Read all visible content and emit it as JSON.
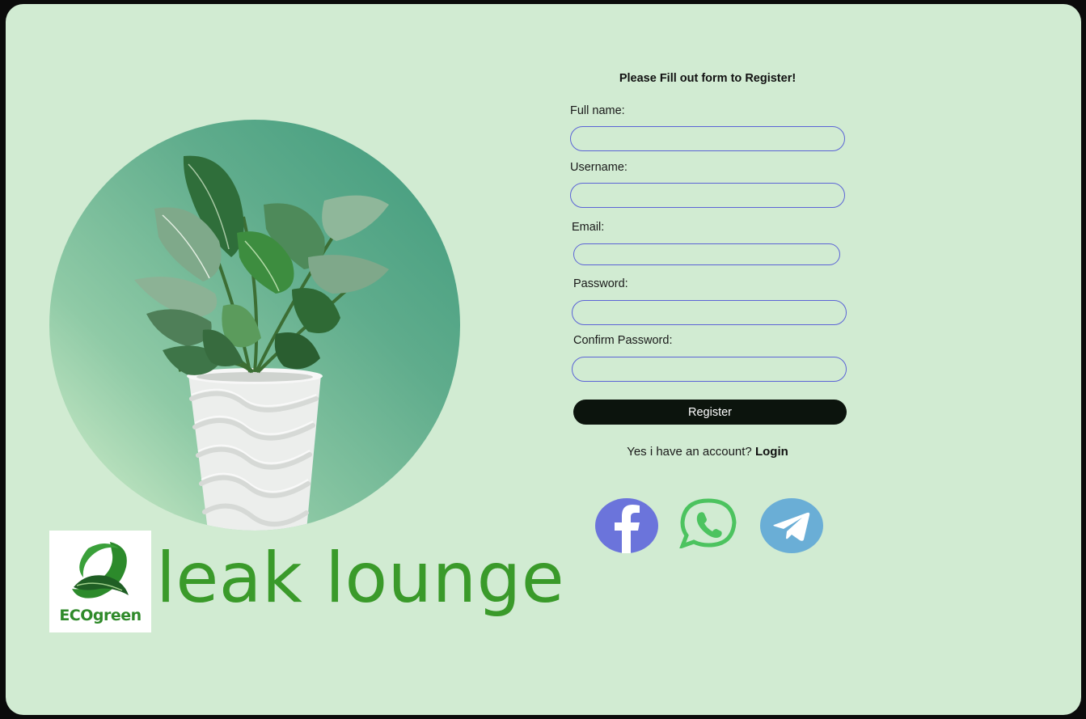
{
  "form": {
    "title": "Please Fill out form to Register!",
    "fields": [
      {
        "label": "Full name:",
        "value": "",
        "placeholder": ""
      },
      {
        "label": "Username:",
        "value": "",
        "placeholder": ""
      },
      {
        "label": "Email:",
        "value": "",
        "placeholder": ""
      },
      {
        "label": "Password:",
        "value": "",
        "placeholder": ""
      },
      {
        "label": "Confirm Password:",
        "value": "",
        "placeholder": ""
      }
    ],
    "register_label": "Register",
    "account_prompt": "Yes i have an account?",
    "login_label": "Login"
  },
  "brand": {
    "logo_text": "ECOgreen",
    "name": "leak lounge"
  },
  "social": {
    "icons": [
      "facebook-icon",
      "whatsapp-icon",
      "telegram-icon"
    ],
    "colors": {
      "facebook": "#6b74db",
      "whatsapp": "#4cc35f",
      "telegram": "#6aaed6"
    }
  },
  "colors": {
    "background": "#d1ebd2",
    "brand_green": "#3a9a2a",
    "field_border": "#5b63d6",
    "button": "#0c140d"
  }
}
